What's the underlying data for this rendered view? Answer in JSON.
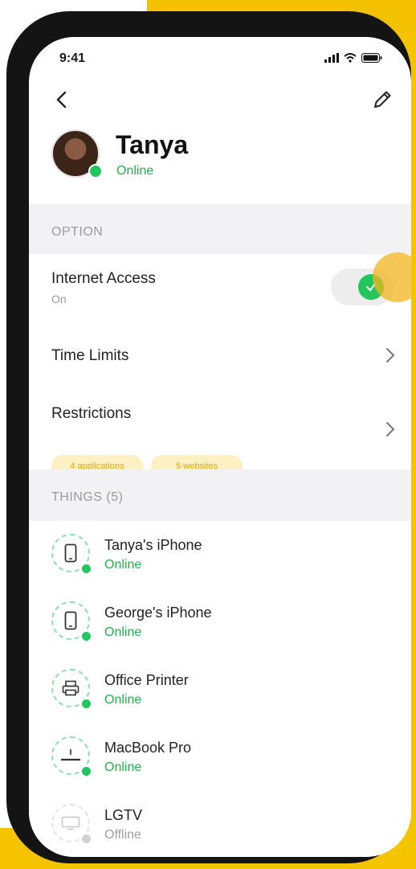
{
  "status_bar": {
    "time": "9:41"
  },
  "profile": {
    "name": "Tanya",
    "status": "Online"
  },
  "colors": {
    "accent_yellow": "#f5c400",
    "online_green": "#22c55e"
  },
  "option_section": {
    "header": "OPTION",
    "internet_access": {
      "title": "Internet Access",
      "value": "On",
      "enabled": true
    },
    "time_limits": {
      "title": "Time Limits"
    },
    "restrictions": {
      "title": "Restrictions",
      "chips": [
        "4 applications",
        "5 websites"
      ]
    }
  },
  "things_section": {
    "header": "THINGS (5)",
    "items": [
      {
        "name": "Tanya's iPhone",
        "status": "Online",
        "icon": "phone-icon"
      },
      {
        "name": "George's iPhone",
        "status": "Online",
        "icon": "phone-icon"
      },
      {
        "name": "Office Printer",
        "status": "Online",
        "icon": "printer-icon"
      },
      {
        "name": "MacBook Pro",
        "status": "Online",
        "icon": "laptop-icon"
      },
      {
        "name": "LGTV",
        "status": "Offline",
        "icon": "tv-icon"
      }
    ]
  }
}
